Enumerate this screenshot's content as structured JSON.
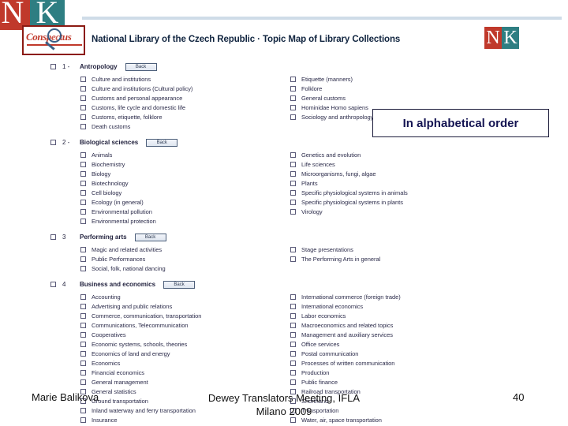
{
  "header": {
    "title": "National Library of the Czech Republic · Topic Map of Library Collections",
    "logo_n": "N",
    "logo_k": "K",
    "conspectus_label": "Conspectus",
    "colors": {
      "logo_red": "#c0392b",
      "logo_teal": "#2e7e82",
      "rule_blue": "#cfdce8",
      "title_navy": "#10243f"
    }
  },
  "callout": {
    "text": "In alphabetical order",
    "color": "#141452"
  },
  "back_label": "Back",
  "sections": [
    {
      "number": "1 -",
      "label": "Antropology",
      "left": [
        "Culture and institutions",
        "Culture and institutions (Cultural policy)",
        "Customs and personal appearance",
        "Customs, life cycle and domestic life",
        "Customs, etiquette, folklore",
        "Death customs"
      ],
      "right": [
        "Etiquette (manners)",
        "Folklore",
        "General customs",
        "Hominidae Homo sapiens",
        "Sociology and anthropology"
      ]
    },
    {
      "number": "2 -",
      "label": "Biological sciences",
      "left": [
        "Animals",
        "Biochemistry",
        "Biology",
        "Biotechnology",
        "Cell biology",
        "Ecology (in general)",
        "Environmental pollution",
        "Environmental protection"
      ],
      "right": [
        "Genetics and evolution",
        "Life sciences",
        "Microorganisms, fungi, algae",
        "Plants",
        "Specific physiological systems in animals",
        "Specific physiological systems in plants",
        "Virology"
      ]
    },
    {
      "number": "3",
      "label": "Performing arts",
      "left": [
        "Magic and related activities",
        "Public Performances",
        "Social, folk, national dancing"
      ],
      "right": [
        "Stage presentations",
        "The Performing Arts in general"
      ]
    },
    {
      "number": "4",
      "label": "Business and economics",
      "left": [
        "Accounting",
        "Advertising and public relations",
        "Commerce, communication, transportation",
        "Communications, Telecommunication",
        "Cooperatives",
        "Economic systems, schools, theories",
        "Economics of land and energy",
        "Economics",
        "Financial economics",
        "General management",
        "General statistics",
        "Ground transportation",
        "Inland waterway and ferry transportation",
        "Insurance"
      ],
      "right": [
        "International commerce (foreign trade)",
        "International economics",
        "Labor economics",
        "Macroeconomics and related topics",
        "Management and auxiliary services",
        "Office services",
        "Postal communication",
        "Processes of written communication",
        "Production",
        "Public finance",
        "Railroad transportation",
        "Shorthand",
        "Transportation",
        "Water, air, space transportation"
      ]
    }
  ],
  "footer": {
    "author": "Marie Balikova",
    "meeting_line1": "Dewey Translators Meeting, IFLA",
    "meeting_line2": "Milano 2009",
    "page_number": "40"
  }
}
